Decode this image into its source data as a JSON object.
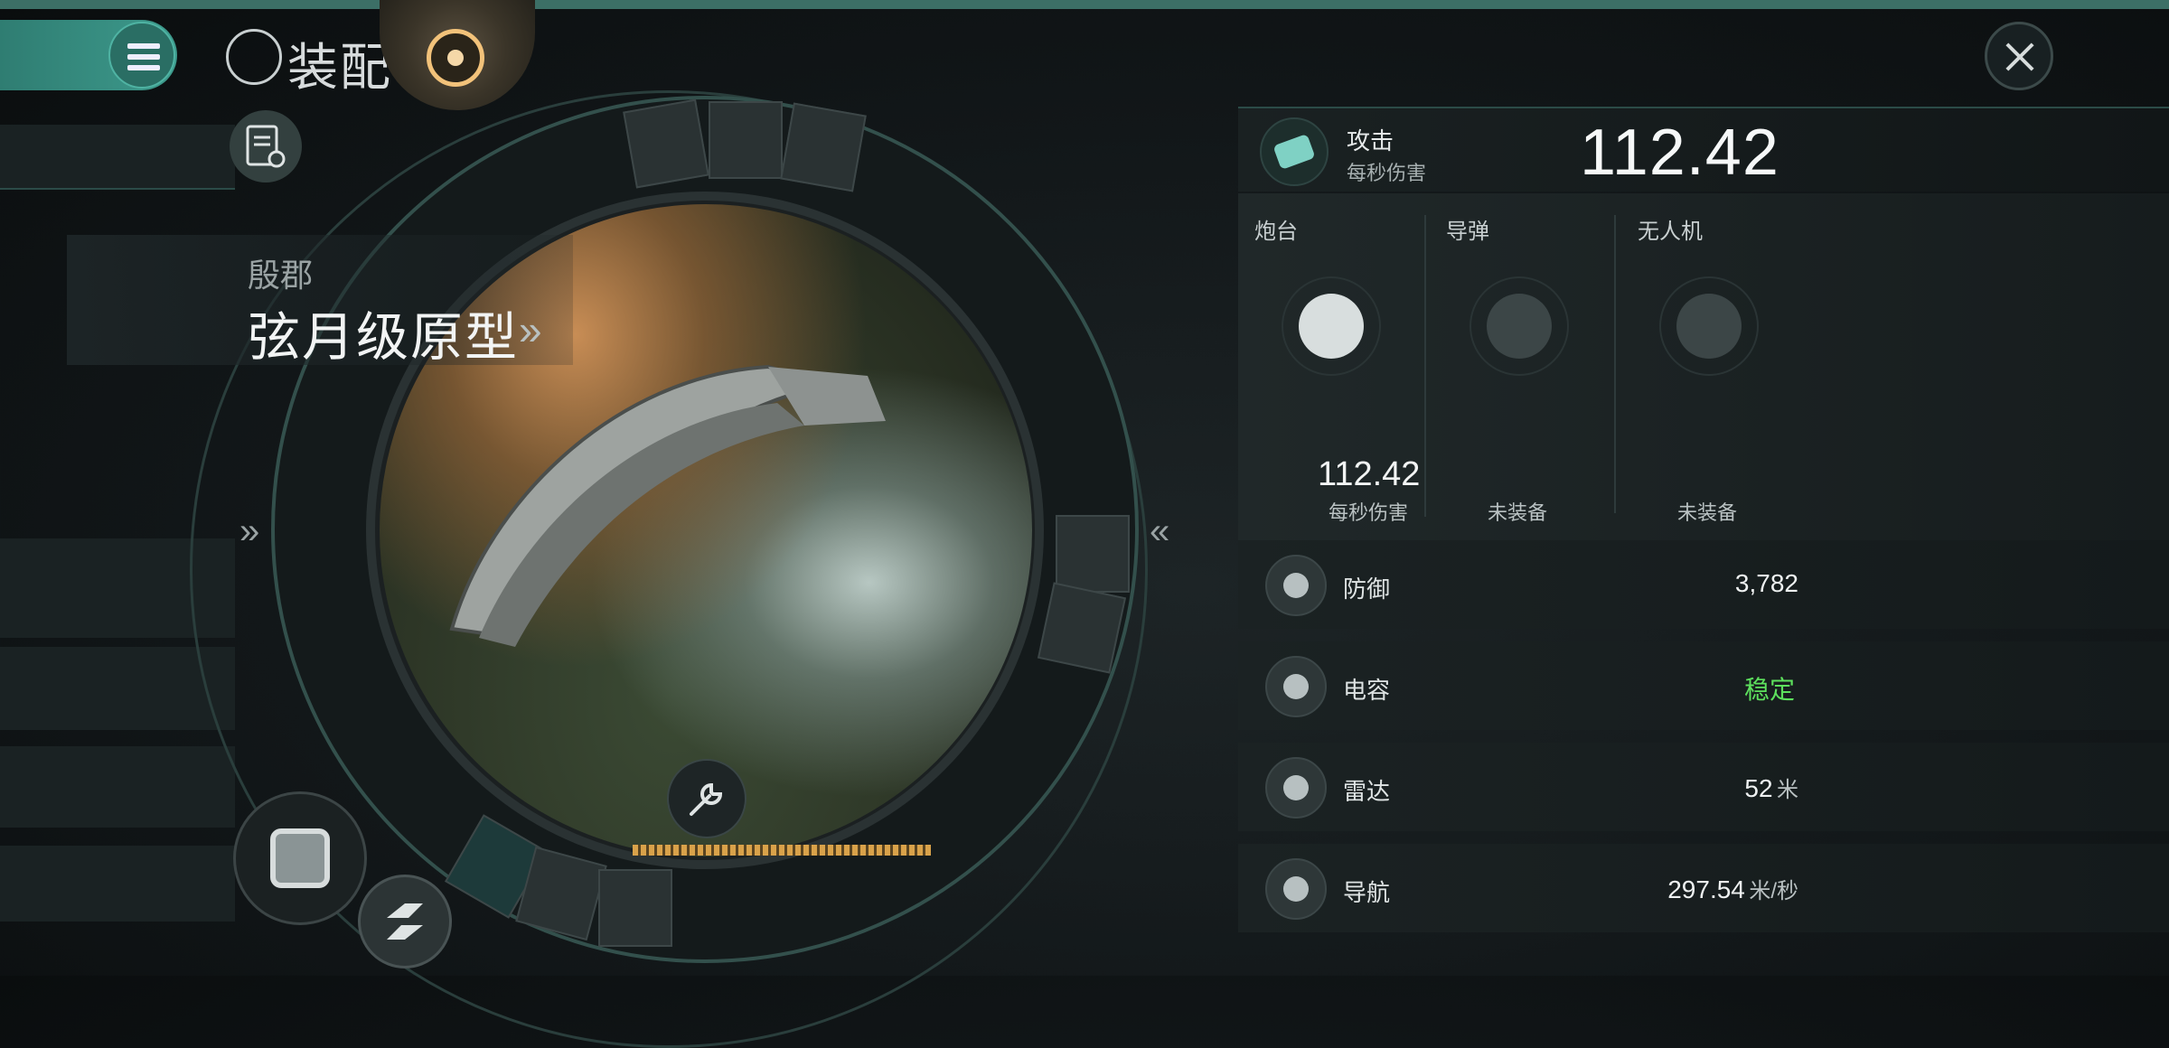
{
  "header": {
    "title": "装配"
  },
  "ship": {
    "faction": "殷郡",
    "name": "弦月级原型",
    "more_arrow": "»"
  },
  "nav": {
    "left_chevron": "»",
    "right_chevron": "«"
  },
  "attack": {
    "label": "攻击",
    "sub": "每秒伤害",
    "dps": "112.42"
  },
  "weapons": [
    {
      "label": "炮台",
      "value": "112.42",
      "value_sub": "每秒伤害",
      "status": ""
    },
    {
      "label": "导弹",
      "status": "未装备"
    },
    {
      "label": "无人机",
      "status": "未装备"
    }
  ],
  "stats": [
    {
      "label": "防御",
      "value": "3,782",
      "unit": "",
      "icon": "shield-icon"
    },
    {
      "label": "电容",
      "value": "稳定",
      "unit": "",
      "icon": "capacitor-icon",
      "color": "#5de05d"
    },
    {
      "label": "雷达",
      "value": "52",
      "unit": "米",
      "icon": "radar-icon"
    },
    {
      "label": "导航",
      "value": "297.54",
      "unit": "米/秒",
      "icon": "navigation-icon"
    }
  ],
  "colors": {
    "accent": "#3d9a8c",
    "stable": "#5de05d",
    "capacitor_bar": "#d9a24a"
  }
}
